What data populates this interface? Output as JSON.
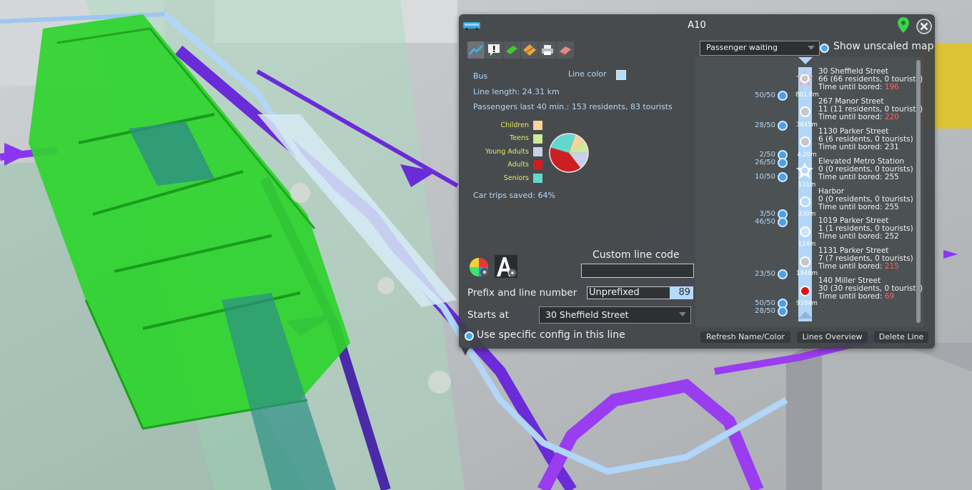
{
  "panel": {
    "title": "A10",
    "info": {
      "line_type": "Bus",
      "line_color_label": "Line color",
      "line_color": "#b6d9ff",
      "line_length": "Line length: 24.31 km",
      "passengers": "Passengers last 40 min.: 153 residents, 83 tourists",
      "car_trips_saved": "Car trips saved: 64%"
    },
    "age_groups": [
      {
        "label": "Children",
        "color": "#f8d39a"
      },
      {
        "label": "Teens",
        "color": "#cfe8a0"
      },
      {
        "label": "Young Adults",
        "color": "#c8d0ea"
      },
      {
        "label": "Adults",
        "color": "#cc1f24"
      },
      {
        "label": "Seniors",
        "color": "#62d8cc"
      }
    ],
    "custom_line_code_label": "Custom line code",
    "custom_line_code_value": "",
    "prefix_label": "Prefix and line number",
    "prefix_value": "Unprefixed",
    "line_number": "89",
    "starts_at_label": "Starts at",
    "starts_at_value": "30 Sheffield Street",
    "specific_config_label": "Use specific config in this line",
    "view_select": "Passenger waiting",
    "show_unscaled_label": "Show unscaled map",
    "buttons": {
      "refresh": "Refresh Name/Color",
      "overview": "Lines Overview",
      "delete": "Delete Line"
    }
  },
  "stops": [
    {
      "name": "30 Sheffield Street",
      "info": "66 (66 residents, 0 tourists)",
      "bored_label": "Time until bored: ",
      "bored": "196",
      "critical": true
    },
    {
      "name": "267 Manor Street",
      "info": "11 (11 residents, 0 tourists)",
      "bored_label": "Time until bored: ",
      "bored": "220",
      "critical": true
    },
    {
      "name": "1130 Parker Street",
      "info": "6 (6 residents, 0 tourists)",
      "bored_label": "Time until bored: ",
      "bored": "231",
      "critical": false
    },
    {
      "name": "Elevated Metro Station",
      "info": "0 (0 residents, 0 tourists)",
      "bored_label": "Time until bored: ",
      "bored": "255",
      "critical": false
    },
    {
      "name": "Harbor",
      "info": "0 (0 residents, 0 tourists)",
      "bored_label": "Time until bored: ",
      "bored": "255",
      "critical": false
    },
    {
      "name": "1019 Parker Street",
      "info": "1 (1 residents, 0 tourists)",
      "bored_label": "Time until bored: ",
      "bored": "252",
      "critical": false
    },
    {
      "name": "1131 Parker Street",
      "info": "7 (7 residents, 0 tourists)",
      "bored_label": "Time until bored: ",
      "bored": "215",
      "critical": true
    },
    {
      "name": "140 Miller Street",
      "info": "30 (30 residents, 0 tourists)",
      "bored_label": "Time until bored: ",
      "bored": "69",
      "critical": true
    }
  ],
  "distances": [
    "801.8m",
    "3645m",
    "4.20m",
    "131m",
    "330m",
    "124m",
    "1946m",
    "9184m"
  ],
  "vehicles": [
    "50/50",
    "28/50",
    "2/50",
    "26/50",
    "10/50",
    "3/50",
    "46/50",
    "23/50",
    "50/50",
    "28/50"
  ],
  "pie": {
    "children": 0.09,
    "teens": 0.1,
    "young_adults": 0.15,
    "adults": 0.4,
    "seniors": 0.26
  }
}
